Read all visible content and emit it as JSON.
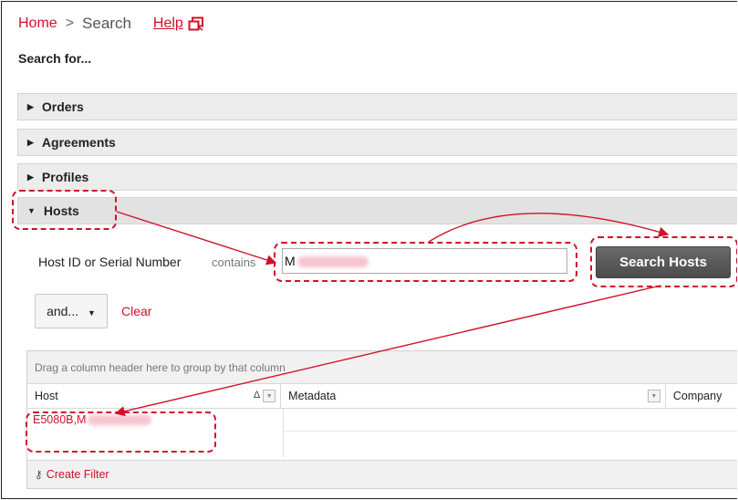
{
  "breadcrumb": {
    "home": "Home",
    "separator": ">",
    "current": "Search",
    "help": "Help"
  },
  "heading": "Search for...",
  "sections": [
    {
      "label": "Orders",
      "expanded": false
    },
    {
      "label": "Agreements",
      "expanded": false
    },
    {
      "label": "Profiles",
      "expanded": false
    },
    {
      "label": "Hosts",
      "expanded": true
    }
  ],
  "hosts": {
    "field_label": "Host ID or Serial Number",
    "operator": "contains",
    "input_value": "M",
    "search_button": "Search Hosts",
    "and_button": "and...",
    "clear_link": "Clear"
  },
  "grid": {
    "group_hint": "Drag a column header here to group by that column",
    "columns": [
      "Host",
      "Metadata",
      "Company"
    ],
    "sort_indicator": "Δ",
    "rows": [
      {
        "host": "E5080B,M"
      }
    ],
    "create_filter": "Create Filter"
  },
  "colors": {
    "accent": "#d0112b",
    "button_dark": "#555555",
    "section_bg": "#ececec"
  }
}
